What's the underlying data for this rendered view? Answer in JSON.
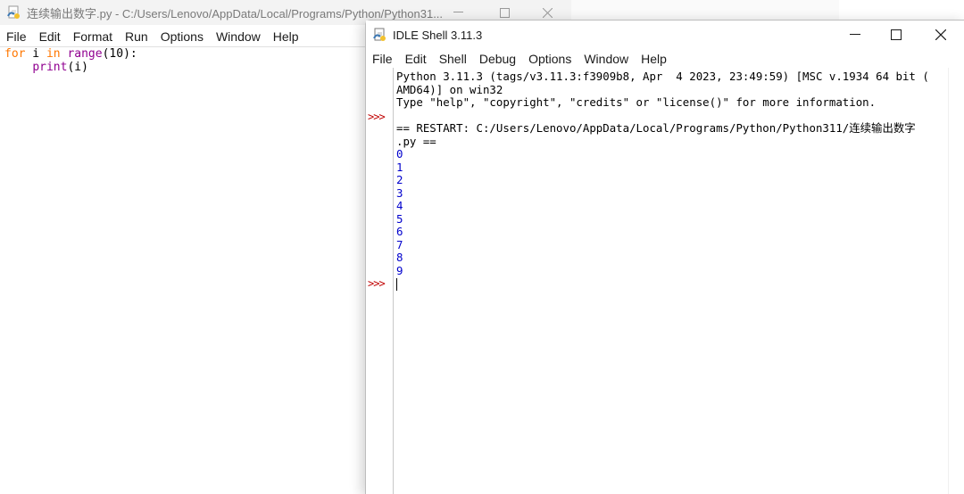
{
  "editor": {
    "title": "连续输出数字.py - C:/Users/Lenovo/AppData/Local/Programs/Python/Python31...",
    "menu": [
      "File",
      "Edit",
      "Format",
      "Run",
      "Options",
      "Window",
      "Help"
    ],
    "code": {
      "line1": {
        "kw1": "for",
        "t1": " i ",
        "kw2": "in",
        "t2": " ",
        "fn": "range",
        "t3": "(10):"
      },
      "line2": {
        "indent": "    ",
        "fn": "print",
        "t1": "(i)"
      }
    }
  },
  "shell": {
    "title": "IDLE Shell 3.11.3",
    "menu": [
      "File",
      "Edit",
      "Shell",
      "Debug",
      "Options",
      "Window",
      "Help"
    ],
    "prompt": ">>>",
    "banner_line1": "Python 3.11.3 (tags/v3.11.3:f3909b8, Apr  4 2023, 23:49:59) [MSC v.1934 64 bit (",
    "banner_line2": "AMD64)] on win32",
    "banner_line3": "Type \"help\", \"copyright\", \"credits\" or \"license()\" for more information.",
    "restart_line1": "== RESTART: C:/Users/Lenovo/AppData/Local/Programs/Python/Python311/连续输出数字",
    "restart_line2": ".py ==",
    "output": [
      "0",
      "1",
      "2",
      "3",
      "4",
      "5",
      "6",
      "7",
      "8",
      "9"
    ]
  },
  "colors": {
    "keyword": "#ff7700",
    "builtin": "#900090",
    "stdout": "#0000cc",
    "prompt": "#c00000"
  },
  "icons": {
    "window_icon": "python-idle-icon"
  }
}
